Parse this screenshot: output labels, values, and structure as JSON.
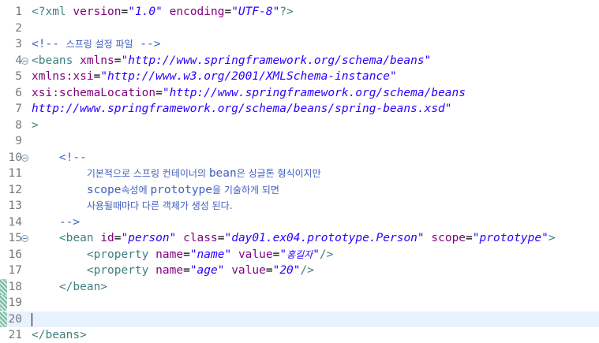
{
  "editor": {
    "lines": [
      {
        "n": "1",
        "fold": false,
        "changed": false,
        "current": false,
        "parts": [
          [
            "tag",
            "<?xml "
          ],
          [
            "attr",
            "version"
          ],
          [
            "txt",
            "="
          ],
          [
            "val",
            "\"1.0\""
          ],
          [
            "txt",
            " "
          ],
          [
            "attr",
            "encoding"
          ],
          [
            "txt",
            "="
          ],
          [
            "val",
            "\"UTF-8\""
          ],
          [
            "tag",
            "?>"
          ]
        ]
      },
      {
        "n": "2",
        "fold": false,
        "changed": false,
        "current": false,
        "parts": []
      },
      {
        "n": "3",
        "fold": false,
        "changed": false,
        "current": false,
        "parts": [
          [
            "com",
            "<!-- "
          ],
          [
            "comk",
            "스프링 설정 파일"
          ],
          [
            "com",
            " -->"
          ]
        ]
      },
      {
        "n": "4",
        "fold": true,
        "changed": false,
        "current": false,
        "parts": [
          [
            "tag",
            "<beans "
          ],
          [
            "attr",
            "xmlns"
          ],
          [
            "txt",
            "="
          ],
          [
            "val",
            "\"http://www.springframework.org/schema/beans\""
          ]
        ]
      },
      {
        "n": "5",
        "fold": false,
        "changed": false,
        "current": false,
        "parts": [
          [
            "attr",
            "xmlns:xsi"
          ],
          [
            "txt",
            "="
          ],
          [
            "val",
            "\"http://www.w3.org/2001/XMLSchema-instance\""
          ]
        ]
      },
      {
        "n": "6",
        "fold": false,
        "changed": false,
        "current": false,
        "parts": [
          [
            "attr",
            "xsi:schemaLocation"
          ],
          [
            "txt",
            "="
          ],
          [
            "val",
            "\"http://www.springframework.org/schema/beans"
          ]
        ]
      },
      {
        "n": "7",
        "fold": false,
        "changed": false,
        "current": false,
        "parts": [
          [
            "val",
            "http://www.springframework.org/schema/beans/spring-beans.xsd\""
          ]
        ]
      },
      {
        "n": "8",
        "fold": false,
        "changed": false,
        "current": false,
        "parts": [
          [
            "tag",
            ">"
          ]
        ]
      },
      {
        "n": "9",
        "fold": false,
        "changed": false,
        "current": false,
        "parts": []
      },
      {
        "n": "10",
        "fold": true,
        "changed": false,
        "current": false,
        "parts": [
          [
            "txt",
            "    "
          ],
          [
            "com",
            "<!--"
          ]
        ]
      },
      {
        "n": "11",
        "fold": false,
        "changed": false,
        "current": false,
        "parts": [
          [
            "txt",
            "        "
          ],
          [
            "comk",
            "기본적으로 스프링 컨테이너의 "
          ],
          [
            "com",
            "bean"
          ],
          [
            "comk",
            "은 싱글톤 형식이지만"
          ]
        ]
      },
      {
        "n": "12",
        "fold": false,
        "changed": false,
        "current": false,
        "parts": [
          [
            "txt",
            "        "
          ],
          [
            "com",
            "scope"
          ],
          [
            "comk",
            "속성에 "
          ],
          [
            "com",
            "prototype"
          ],
          [
            "comk",
            "을 기술하게 되면"
          ]
        ]
      },
      {
        "n": "13",
        "fold": false,
        "changed": false,
        "current": false,
        "parts": [
          [
            "txt",
            "        "
          ],
          [
            "comk",
            "사용될때마다 다른 객체가 생성 된다."
          ]
        ]
      },
      {
        "n": "14",
        "fold": false,
        "changed": false,
        "current": false,
        "parts": [
          [
            "txt",
            "    "
          ],
          [
            "com",
            "-->"
          ]
        ]
      },
      {
        "n": "15",
        "fold": true,
        "changed": false,
        "current": false,
        "parts": [
          [
            "txt",
            "    "
          ],
          [
            "tag",
            "<bean "
          ],
          [
            "attr",
            "id"
          ],
          [
            "txt",
            "="
          ],
          [
            "val",
            "\"person\""
          ],
          [
            "txt",
            " "
          ],
          [
            "attr",
            "class"
          ],
          [
            "txt",
            "="
          ],
          [
            "val",
            "\"day01.ex04.prototype.Person\""
          ],
          [
            "txt",
            " "
          ],
          [
            "attr",
            "scope"
          ],
          [
            "txt",
            "="
          ],
          [
            "val",
            "\"prototype\""
          ],
          [
            "tag",
            ">"
          ]
        ]
      },
      {
        "n": "16",
        "fold": false,
        "changed": false,
        "current": false,
        "parts": [
          [
            "txt",
            "        "
          ],
          [
            "tag",
            "<property "
          ],
          [
            "attr",
            "name"
          ],
          [
            "txt",
            "="
          ],
          [
            "val",
            "\"name\""
          ],
          [
            "txt",
            " "
          ],
          [
            "attr",
            "value"
          ],
          [
            "txt",
            "="
          ],
          [
            "val",
            "\""
          ],
          [
            "valk",
            "홍길자"
          ],
          [
            "val",
            "\""
          ],
          [
            "tag",
            "/>"
          ]
        ]
      },
      {
        "n": "17",
        "fold": false,
        "changed": false,
        "current": false,
        "parts": [
          [
            "txt",
            "        "
          ],
          [
            "tag",
            "<property "
          ],
          [
            "attr",
            "name"
          ],
          [
            "txt",
            "="
          ],
          [
            "val",
            "\"age\""
          ],
          [
            "txt",
            " "
          ],
          [
            "attr",
            "value"
          ],
          [
            "txt",
            "="
          ],
          [
            "val",
            "\"20\""
          ],
          [
            "tag",
            "/>"
          ]
        ]
      },
      {
        "n": "18",
        "fold": false,
        "changed": true,
        "current": false,
        "parts": [
          [
            "txt",
            "    "
          ],
          [
            "tag",
            "</bean>"
          ]
        ]
      },
      {
        "n": "19",
        "fold": false,
        "changed": true,
        "current": false,
        "parts": []
      },
      {
        "n": "20",
        "fold": false,
        "changed": true,
        "current": true,
        "parts": []
      },
      {
        "n": "21",
        "fold": false,
        "changed": false,
        "current": false,
        "parts": [
          [
            "tag",
            "</beans>"
          ]
        ]
      }
    ]
  }
}
